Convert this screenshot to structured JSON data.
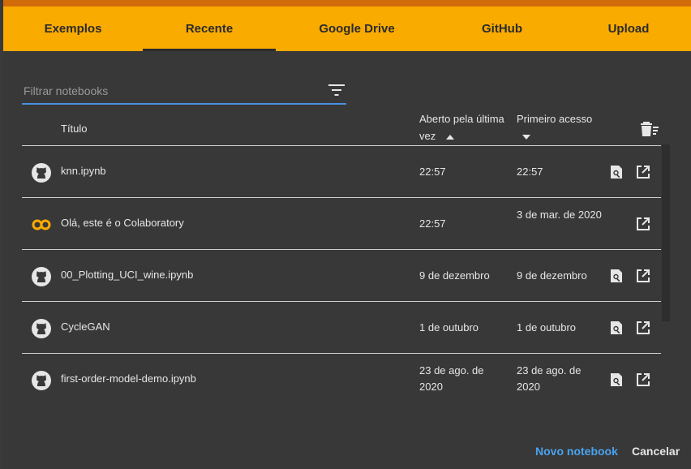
{
  "tabs": [
    {
      "label": "Exemplos",
      "active": false
    },
    {
      "label": "Recente",
      "active": true
    },
    {
      "label": "Google Drive",
      "active": false
    },
    {
      "label": "GitHub",
      "active": false
    },
    {
      "label": "Upload",
      "active": false
    }
  ],
  "filter": {
    "placeholder": "Filtrar notebooks",
    "value": "",
    "icon": "filter-list-icon"
  },
  "table": {
    "headers": {
      "title": "Título",
      "opened": "Aberto pela última vez",
      "first": "Primeiro acesso"
    },
    "sort": {
      "opened": "ascending",
      "first": "descending"
    },
    "rows": [
      {
        "icon": "github-icon",
        "name": "knn.ipynb",
        "opened": "22:57",
        "first": "22:57",
        "preview": true
      },
      {
        "icon": "colab-icon",
        "name": "Olá, este é o Colaboratory",
        "opened": "22:57",
        "first": "3 de mar. de 2020",
        "preview": false
      },
      {
        "icon": "github-icon",
        "name": "00_Plotting_UCI_wine.ipynb",
        "opened": "9 de dezembro",
        "first": "9 de dezembro",
        "preview": true
      },
      {
        "icon": "github-icon",
        "name": "CycleGAN",
        "opened": "1 de outubro",
        "first": "1 de outubro",
        "preview": true
      },
      {
        "icon": "github-icon",
        "name": "first-order-model-demo.ipynb",
        "opened": "23 de ago. de 2020",
        "first": "23 de ago. de 2020",
        "preview": true
      }
    ]
  },
  "actions": {
    "new_notebook": "Novo notebook",
    "cancel": "Cancelar"
  },
  "colors": {
    "tab_bar": "#f9ab00",
    "accent_blue": "#4aa3f0",
    "dialog_bg": "#383838",
    "colab_orange": "#f9ab00"
  }
}
